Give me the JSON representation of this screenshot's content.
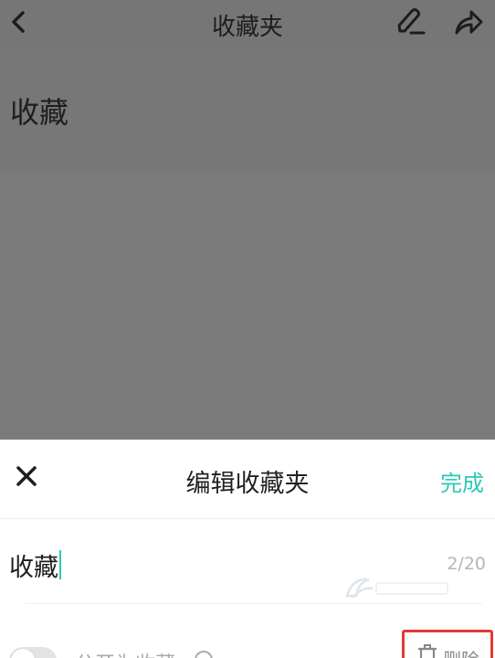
{
  "topbar": {
    "title": "收藏夹"
  },
  "folder": {
    "name": "收藏"
  },
  "edit_sheet": {
    "title": "编辑收藏夹",
    "done_label": "完成",
    "name_value": "收藏",
    "char_count": "2/20",
    "private_label": "公开为收藏",
    "delete_label": "删除"
  },
  "colors": {
    "accent": "#2ec8b6",
    "delete_border": "#e33a36",
    "overlay": "#7a7a7a"
  },
  "icons": {
    "back": "chevron-left-icon",
    "edit": "pencil-icon",
    "share": "share-arrow-icon",
    "close": "close-icon",
    "help": "help-circle-icon",
    "trash": "trash-icon"
  }
}
